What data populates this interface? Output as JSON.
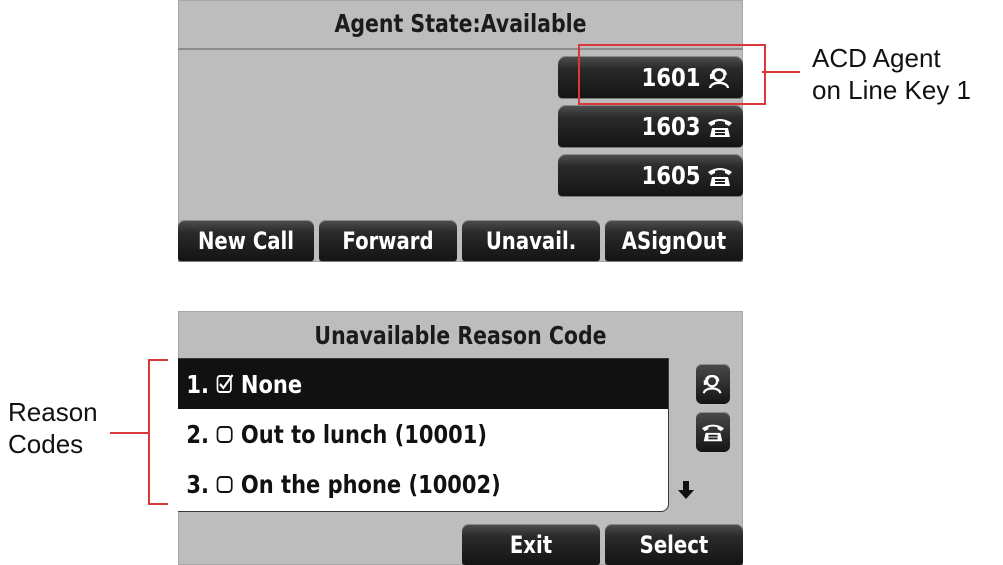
{
  "screen1": {
    "title": "Agent State:Available",
    "line_keys": [
      {
        "number": "1601",
        "icon": "acd-agent-icon"
      },
      {
        "number": "1603",
        "icon": "phone-icon"
      },
      {
        "number": "1605",
        "icon": "phone-icon"
      }
    ],
    "softkeys": [
      "New Call",
      "Forward",
      "Unavail.",
      "ASignOut"
    ]
  },
  "screen2": {
    "title": "Unavailable Reason Code",
    "items": [
      {
        "index": "1.",
        "label": "None",
        "checked": true
      },
      {
        "index": "2.",
        "label": "Out to lunch (10001)",
        "checked": false
      },
      {
        "index": "3.",
        "label": "On the phone (10002)",
        "checked": false
      }
    ],
    "softkeys": [
      "Exit",
      "Select"
    ]
  },
  "annotations": {
    "acd_agent": "ACD Agent\non Line Key 1",
    "reason_codes": "Reason\nCodes"
  },
  "colors": {
    "screen_bg": "#bdbdbd",
    "key_bg": "#1a1a1a",
    "annotation_red": "#d9383a"
  }
}
